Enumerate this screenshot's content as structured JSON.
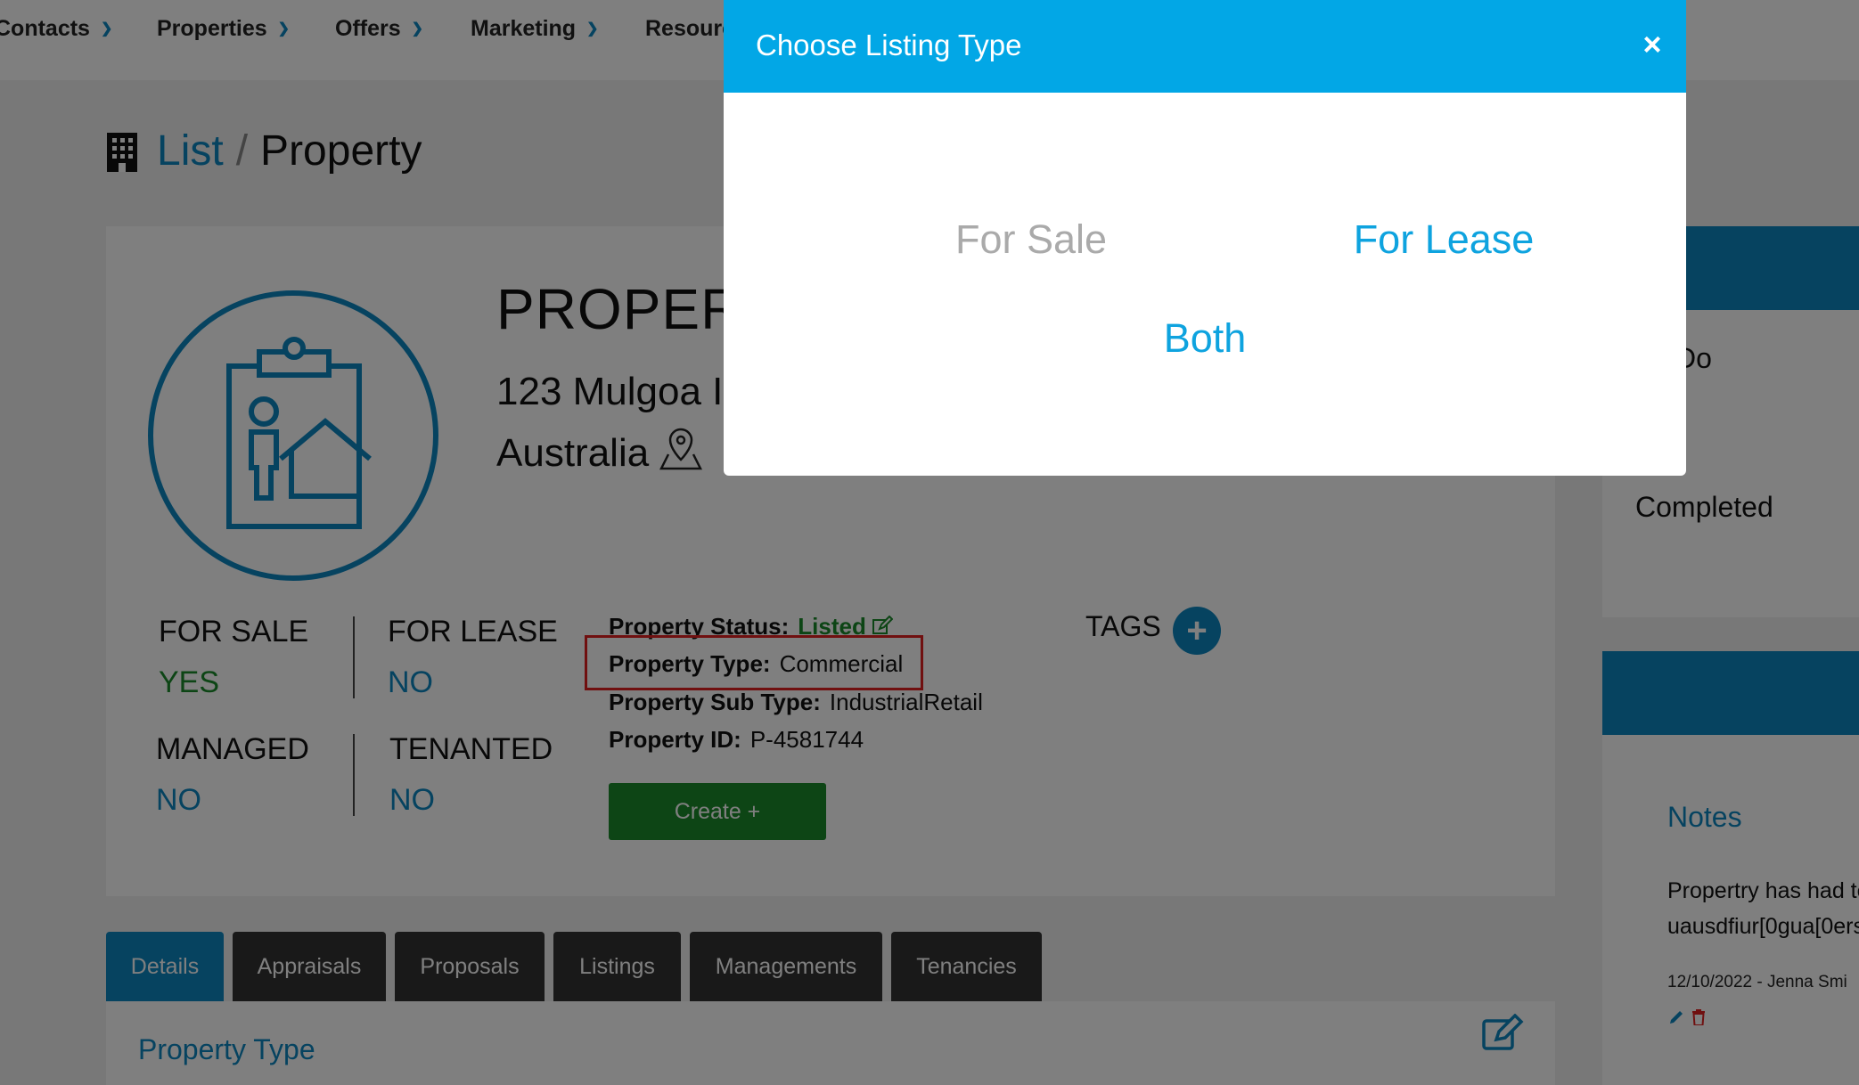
{
  "nav": {
    "items": [
      {
        "label": "Contacts"
      },
      {
        "label": "Properties"
      },
      {
        "label": "Offers"
      },
      {
        "label": "Marketing"
      },
      {
        "label": "Resourc"
      }
    ]
  },
  "breadcrumb": {
    "link": "List",
    "separator": "/",
    "current": "Property"
  },
  "property": {
    "title": "PROPERT",
    "address_line1": "123 Mulgoa I",
    "address_line2": "Australia",
    "for_sale_label": "FOR SALE",
    "for_sale_value": "YES",
    "for_lease_label": "FOR LEASE",
    "for_lease_value": "NO",
    "managed_label": "MANAGED",
    "managed_value": "NO",
    "tenanted_label": "TENANTED",
    "tenanted_value": "NO",
    "status_label": "Property Status:",
    "status_value": "Listed",
    "type_label": "Property Type:",
    "type_value": "Commercial",
    "subtype_label": "Property Sub Type:",
    "subtype_value": "IndustrialRetail",
    "id_label": "Property ID:",
    "id_value": "P-4581744",
    "create_label": "Create +",
    "tags_label": "TAGS",
    "tags_add": "+"
  },
  "tabs": [
    {
      "label": "Details",
      "active": true
    },
    {
      "label": "Appraisals"
    },
    {
      "label": "Proposals"
    },
    {
      "label": "Listings"
    },
    {
      "label": "Managements"
    },
    {
      "label": "Tenancies"
    }
  ],
  "details": {
    "heading": "Property Type"
  },
  "right": {
    "todo": "Do",
    "completed": "Completed",
    "notes_heading": "Notes",
    "note_line1": "Propertry has had te",
    "note_line2": "uausdfiur[0gua[0ers",
    "note_meta": "12/10/2022 - Jenna Smi"
  },
  "modal": {
    "title": "Choose Listing Type",
    "close": "×",
    "option_sale": "For Sale",
    "option_lease": "For Lease",
    "option_both": "Both"
  },
  "colors": {
    "brand_blue": "#0d86c0",
    "modal_header": "#02a7e6",
    "green": "#1a8a2a",
    "highlight": "#e02020"
  }
}
